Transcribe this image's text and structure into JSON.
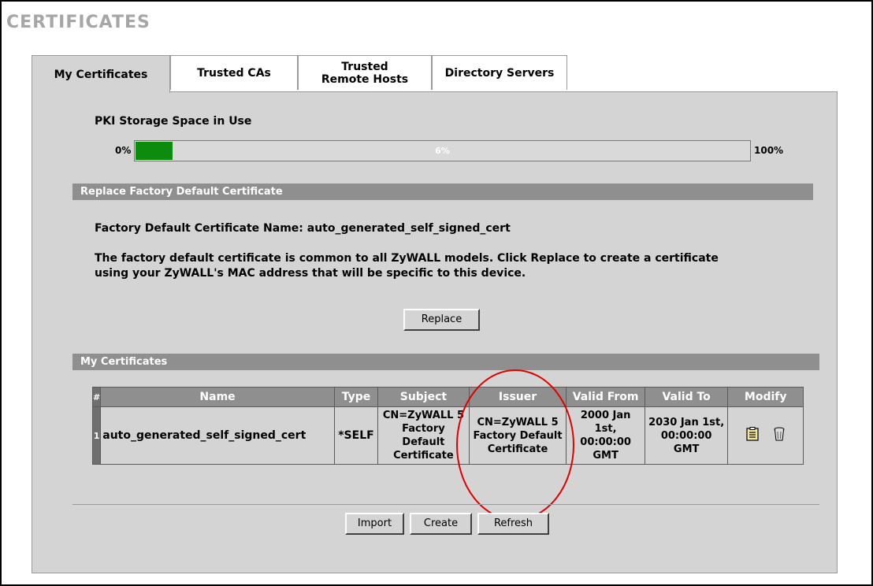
{
  "page": {
    "title": "CERTIFICATES"
  },
  "tabs": [
    {
      "label": "My Certificates",
      "active": true
    },
    {
      "label": "Trusted CAs",
      "active": false
    },
    {
      "label": "Trusted Remote Hosts",
      "active": false
    },
    {
      "label": "Directory Servers",
      "active": false
    }
  ],
  "storage": {
    "label": "PKI Storage Space in Use",
    "min_label": "0%",
    "max_label": "100%",
    "percent_label": "6%",
    "percent_value": 6,
    "bar_color": "#0c8b0c"
  },
  "replace_section": {
    "header": "Replace Factory Default Certificate",
    "name_line": "Factory Default Certificate Name: auto_generated_self_signed_cert",
    "desc_line1": "The factory default certificate is common to all ZyWALL models. Click Replace to create a certificate",
    "desc_line2": "using your ZyWALL's MAC address that will be specific to this device.",
    "replace_button": "Replace"
  },
  "certs_section": {
    "header": "My Certificates",
    "columns": [
      "#",
      "Name",
      "Type",
      "Subject",
      "Issuer",
      "Valid From",
      "Valid To",
      "Modify"
    ],
    "rows": [
      {
        "index": "1",
        "name": "auto_generated_self_signed_cert",
        "type": "*SELF",
        "subject": "CN=ZyWALL 5 Factory Default Certificate",
        "issuer": "CN=ZyWALL 5 Factory Default Certificate",
        "valid_from": "2000 Jan 1st, 00:00:00 GMT",
        "valid_to": "2030 Jan 1st, 00:00:00 GMT",
        "modify_icons": [
          "edit-icon",
          "delete-icon"
        ]
      }
    ]
  },
  "footer_buttons": {
    "import": "Import",
    "create": "Create",
    "refresh": "Refresh"
  },
  "annotation": {
    "circle_color": "#e00000"
  }
}
